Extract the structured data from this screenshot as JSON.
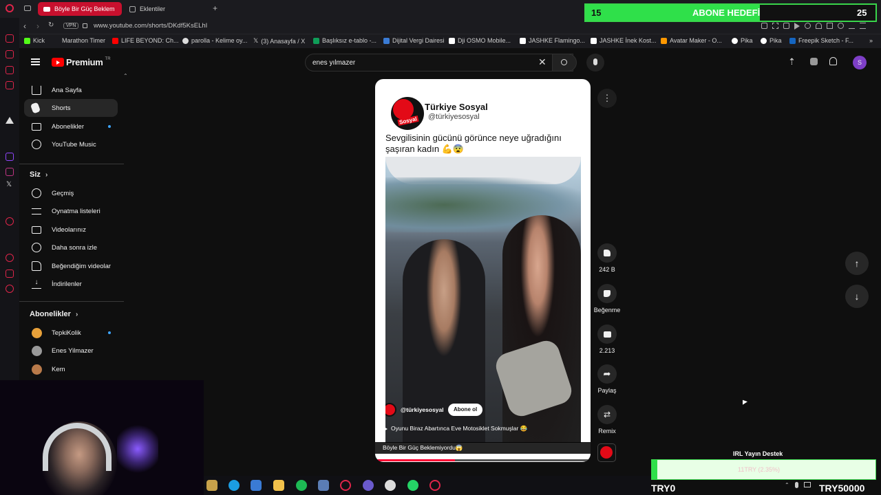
{
  "browser": {
    "tabs": [
      {
        "label": "Böyle Bir Güç Beklem",
        "active": true
      },
      {
        "label": "Eklentiler",
        "active": false
      }
    ],
    "new_tab": "+",
    "url_badge": "VPN",
    "url": "www.youtube.com/shorts/DKdf5KsELhI",
    "bookmarks": [
      {
        "label": "Kick",
        "color": "#53fc18"
      },
      {
        "label": "Marathon Timer",
        "color": "#1b1b1f"
      },
      {
        "label": "LIFE BEYOND: Ch...",
        "color": "#ff0000"
      },
      {
        "label": "parolla - Kelime oy...",
        "color": "#dddddd"
      },
      {
        "label": "(3) Anasayfa / X",
        "color": "#000000"
      },
      {
        "label": "Başlıksız e-tablo -...",
        "color": "#0f9d58"
      },
      {
        "label": "Dijital Vergi Dairesi",
        "color": "#3a7bd5"
      },
      {
        "label": "Dji OSMO Mobile...",
        "color": "#ffffff"
      },
      {
        "label": "JASHKE Flamingo...",
        "color": "#ffffff"
      },
      {
        "label": "JASHKE İnek Kost...",
        "color": "#ffffff"
      },
      {
        "label": "Avatar Maker - O...",
        "color": "#ff9800"
      },
      {
        "label": "Pika",
        "color": "#ffffff"
      },
      {
        "label": "Pika",
        "color": "#ffffff"
      },
      {
        "label": "Freepik Sketch - F...",
        "color": "#1565c0"
      }
    ]
  },
  "youtube": {
    "logo": "Premium",
    "logo_region": "TR",
    "search_value": "enes yılmazer",
    "avatar_letter": "S",
    "nav_main": [
      {
        "label": "Ana Sayfa",
        "icon": "home-icon"
      },
      {
        "label": "Shorts",
        "icon": "shorts-icon"
      },
      {
        "label": "Abonelikler",
        "icon": "subscriptions-icon"
      },
      {
        "label": "YouTube Music",
        "icon": "music-icon"
      }
    ],
    "you_section": "Siz",
    "nav_you": [
      {
        "label": "Geçmiş",
        "icon": "history-icon"
      },
      {
        "label": "Oynatma listeleri",
        "icon": "playlists-icon"
      },
      {
        "label": "Videolarınız",
        "icon": "your-videos-icon"
      },
      {
        "label": "Daha sonra izle",
        "icon": "watch-later-icon"
      },
      {
        "label": "Beğendiğim videolar",
        "icon": "liked-icon"
      },
      {
        "label": "İndirilenler",
        "icon": "downloads-icon"
      }
    ],
    "subs_section": "Abonelikler",
    "subscriptions": [
      {
        "label": "TepkiKolik",
        "color": "#e8a13a"
      },
      {
        "label": "Enes Yilmazer",
        "color": "#9a9a9a"
      },
      {
        "label": "Kem",
        "color": "#b97a4a"
      }
    ]
  },
  "short": {
    "channel_name": "Türkiye Sosyal",
    "channel_handle": "@türkiyesosyal",
    "logo_word": "Sosyal",
    "caption": "Sevgilisinin gücünü görünce neye uğradığını şaşıran kadın 💪😨",
    "overlay_handle": "@türkiyesosyal",
    "subscribe_label": "Abone ol",
    "music_line": "Oyunu Biraz Abartınca Eve Motosiklet Sokmuşlar 😂",
    "title": "Böyle Bir Güç Beklemiyordu😱",
    "progress": 0.37
  },
  "actions": [
    {
      "label": "242 B",
      "icon": "like-icon"
    },
    {
      "label": "Beğenme",
      "icon": "dislike-icon"
    },
    {
      "label": "2.213",
      "icon": "comment-icon"
    },
    {
      "label": "Paylaş",
      "icon": "share-icon"
    },
    {
      "label": "Remix",
      "icon": "remix-icon"
    }
  ],
  "stream_overlay": {
    "goal_current": "15",
    "goal_label": "ABONE HEDEFİ",
    "goal_target": "25",
    "goal_progress": 0.6,
    "donate_title": "IRL Yayın Destek",
    "donate_amount": "11TRY (2.35%)",
    "donate_progress": 0.0235,
    "currency_left": "TRY0",
    "currency_right": "TRY50000"
  }
}
